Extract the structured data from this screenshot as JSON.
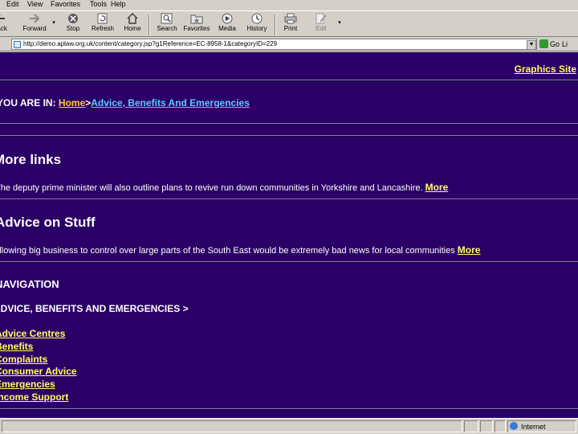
{
  "browser": {
    "menu": [
      "Edit",
      "View",
      "Favorites",
      "Tools",
      "Help"
    ],
    "toolbar": {
      "back": "Back",
      "forward": "Forward",
      "stop": "Stop",
      "refresh": "Refresh",
      "home": "Home",
      "search": "Search",
      "favorites": "Favorites",
      "media": "Media",
      "history": "History",
      "print": "Print",
      "edit": "Edit"
    },
    "address": {
      "url": "http://demo.aplaw.org.uk/content/category.jsp?g1Reference=EC-8958-1&categoryID=229"
    },
    "go_label": "Go",
    "links_label": "Li",
    "status": {
      "zone": "Internet"
    }
  },
  "page": {
    "graphics_site_link": "Graphics Site",
    "breadcrumb": {
      "prefix": "YOU ARE IN: ",
      "home": "Home",
      "separator": ">",
      "current": "Advice, Benefits And Emergencies"
    },
    "more_links": {
      "heading": "More links",
      "text": "The deputy prime minister will also outline plans to revive run down communities in Yorkshire and Lancashire. ",
      "more": "More"
    },
    "advice": {
      "heading": "Advice on Stuff",
      "text": "Allowing big business to control over large parts of the South East would be extremely bad news for local communities ",
      "more": "More"
    },
    "navigation": {
      "heading": "NAVIGATION",
      "section": "ADVICE, BENEFITS AND EMERGENCIES >",
      "items": [
        "Advice Centres",
        "Benefits",
        "Complaints",
        "Consumer Advice",
        "Emergencies",
        "Income Support"
      ]
    }
  },
  "colors": {
    "page_background": "#2b0066",
    "link_yellow": "#ffff66",
    "breadcrumb_home": "#ffcc33",
    "breadcrumb_current": "#55ccff"
  }
}
